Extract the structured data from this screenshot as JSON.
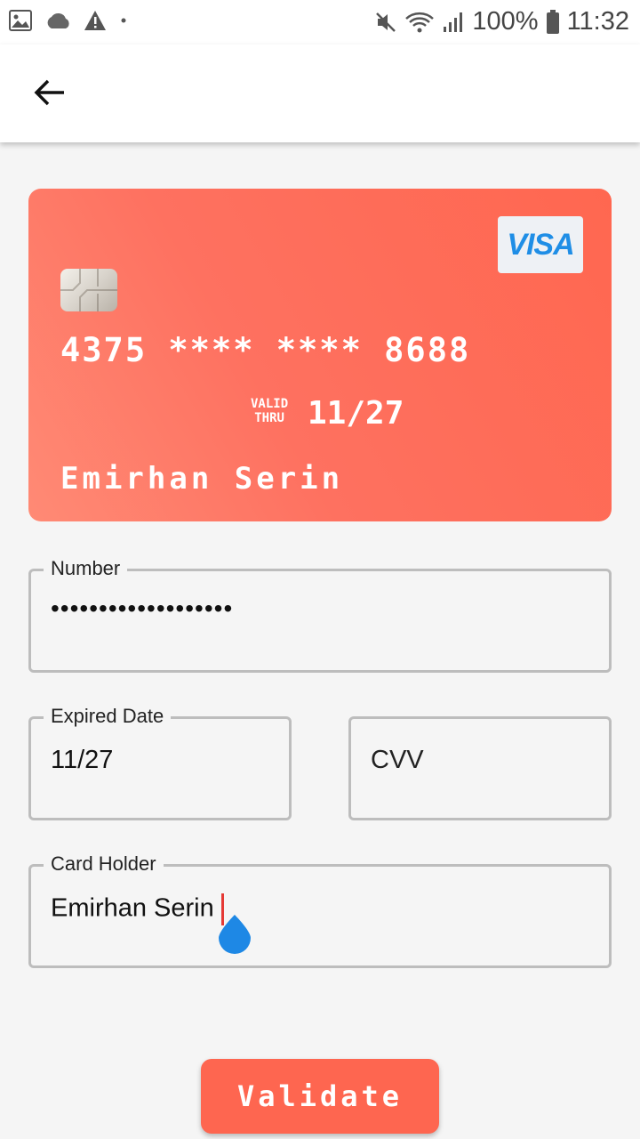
{
  "status_bar": {
    "battery": "100%",
    "time": "11:32",
    "left_icons": [
      "image-icon",
      "cloud-icon",
      "warning-icon",
      "dot-icon"
    ],
    "right_icons": [
      "mute-icon",
      "wifi-icon",
      "signal-icon",
      "battery-icon"
    ]
  },
  "app_bar": {
    "back_icon": "arrow-left-icon"
  },
  "card": {
    "number": "4375 **** **** 8688",
    "valid_label_line1": "VALID",
    "valid_label_line2": "THRU",
    "expiry": "11/27",
    "holder": "Emirhan Serin",
    "brand": "VISA",
    "gradient_color": "#fe7160"
  },
  "form": {
    "number": {
      "label": "Number",
      "value": "•••••••••••••••••••"
    },
    "expiry": {
      "label": "Expired Date",
      "value": "11/27"
    },
    "cvv": {
      "placeholder": "CVV"
    },
    "holder": {
      "label": "Card Holder",
      "value": "Emirhan Serin"
    }
  },
  "actions": {
    "validate_label": "Validate",
    "accent_color": "#fe6650"
  }
}
